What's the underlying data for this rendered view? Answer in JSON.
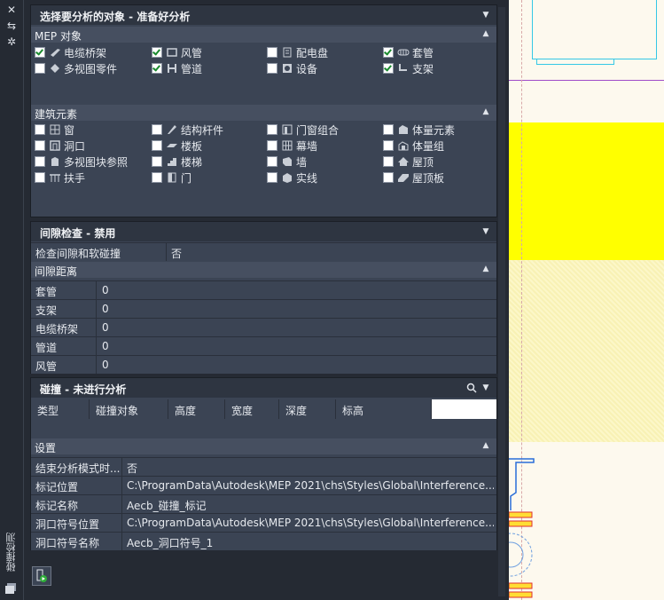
{
  "palette": {
    "title": "碰撞检测"
  },
  "analysis_section": {
    "title": "选择要分析的对象 - 准备好分析",
    "mep": {
      "label": "MEP 对象",
      "items": [
        {
          "label": "电缆桥架",
          "checked": true,
          "icon": "cable-tray-icon"
        },
        {
          "label": "风管",
          "checked": true,
          "icon": "duct-icon"
        },
        {
          "label": "配电盘",
          "checked": false,
          "icon": "panel-icon"
        },
        {
          "label": "套管",
          "checked": true,
          "icon": "sleeve-icon"
        },
        {
          "label": "多视图零件",
          "checked": false,
          "icon": "multiview-part-icon"
        },
        {
          "label": "管道",
          "checked": true,
          "icon": "pipe-icon"
        },
        {
          "label": "设备",
          "checked": false,
          "icon": "equipment-icon"
        },
        {
          "label": "支架",
          "checked": true,
          "icon": "hanger-icon"
        }
      ]
    },
    "arch": {
      "label": "建筑元素",
      "items": [
        {
          "label": "窗",
          "checked": false,
          "icon": "window-icon"
        },
        {
          "label": "结构杆件",
          "checked": false,
          "icon": "structural-member-icon"
        },
        {
          "label": "门窗组合",
          "checked": false,
          "icon": "door-window-assembly-icon"
        },
        {
          "label": "体量元素",
          "checked": false,
          "icon": "mass-element-icon"
        },
        {
          "label": "洞口",
          "checked": false,
          "icon": "opening-icon"
        },
        {
          "label": "楼板",
          "checked": false,
          "icon": "slab-icon"
        },
        {
          "label": "幕墙",
          "checked": false,
          "icon": "curtain-wall-icon"
        },
        {
          "label": "体量组",
          "checked": false,
          "icon": "mass-group-icon"
        },
        {
          "label": "多视图块参照",
          "checked": false,
          "icon": "multiview-block-icon"
        },
        {
          "label": "楼梯",
          "checked": false,
          "icon": "stair-icon"
        },
        {
          "label": "墙",
          "checked": false,
          "icon": "wall-icon"
        },
        {
          "label": "屋顶",
          "checked": false,
          "icon": "roof-icon"
        },
        {
          "label": "扶手",
          "checked": false,
          "icon": "railing-icon"
        },
        {
          "label": "门",
          "checked": false,
          "icon": "door-icon"
        },
        {
          "label": "实线",
          "checked": false,
          "icon": "solid-icon"
        },
        {
          "label": "屋顶板",
          "checked": false,
          "icon": "roof-slab-icon"
        }
      ]
    }
  },
  "clearance_section": {
    "title": "间隙检查 - 禁用",
    "check_row": {
      "label": "检查间隙和软碰撞",
      "value": "否"
    },
    "distance_label": "间隙距离",
    "distances": [
      {
        "label": "套管",
        "value": "0"
      },
      {
        "label": "支架",
        "value": "0"
      },
      {
        "label": "电缆桥架",
        "value": "0"
      },
      {
        "label": "管道",
        "value": "0"
      },
      {
        "label": "风管",
        "value": "0"
      }
    ]
  },
  "collision_section": {
    "title": "碰撞 - 未进行分析",
    "columns": [
      "类型",
      "碰撞对象",
      "高度",
      "宽度",
      "深度",
      "标高"
    ]
  },
  "settings_section": {
    "label": "设置",
    "rows": [
      {
        "label": "结束分析模式时...",
        "value": "否"
      },
      {
        "label": "标记位置",
        "value": "C:\\ProgramData\\Autodesk\\MEP 2021\\chs\\Styles\\Global\\Interference..."
      },
      {
        "label": "标记名称",
        "value": "Aecb_碰撞_标记"
      },
      {
        "label": "洞口符号位置",
        "value": "C:\\ProgramData\\Autodesk\\MEP 2021\\chs\\Styles\\Global\\Interference..."
      },
      {
        "label": "洞口符号名称",
        "value": "Aecb_洞口符号_1"
      }
    ]
  },
  "colors": {
    "panel_bg": "#3b4454",
    "header_bg": "#2e3541",
    "check_green": "#1a8a2e",
    "drawing_yellow": "#ffff00"
  }
}
